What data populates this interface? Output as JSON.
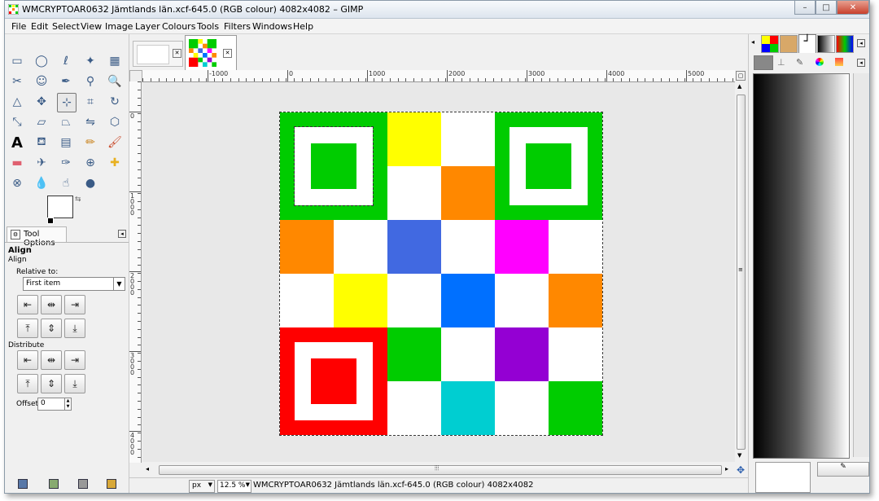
{
  "window": {
    "title": "WMCRYPTOAR0632 Jämtlands län.xcf-645.0 (RGB colour) 4082x4082 – GIMP",
    "minimize": "–",
    "maximize": "□",
    "close": "✕"
  },
  "menu": [
    "File",
    "Edit",
    "Select",
    "View",
    "Image",
    "Layer",
    "Colours",
    "Tools",
    "Filters",
    "Windows",
    "Help"
  ],
  "toolbox": {
    "tools": [
      "rect-select-icon",
      "ellipse-select-icon",
      "free-select-icon",
      "fuzzy-select-icon",
      "color-select-icon",
      "scissors-select-icon",
      "foreground-select-icon",
      "paths-icon",
      "color-picker-icon",
      "zoom-icon",
      "measure-icon",
      "move-icon",
      "align-icon",
      "crop-icon",
      "transform-icon",
      "scale-icon",
      "shear-icon",
      "perspective-icon",
      "flip-icon",
      "cage-icon",
      "text-icon",
      "bucket-fill-icon",
      "blend-icon",
      "pencil-icon",
      "paintbrush-icon",
      "eraser-icon",
      "airbrush-icon",
      "ink-icon",
      "clone-icon",
      "heal-icon",
      "perspective-clone-icon",
      "blur-icon",
      "smudge-icon",
      "dodge-burn-icon"
    ],
    "active_tool": "align-icon"
  },
  "tool_options": {
    "tab_label": "Tool Options",
    "heading": "Align",
    "subheading": "Align",
    "relative_label": "Relative to:",
    "relative_value": "First item",
    "distribute_label": "Distribute",
    "offset_label": "Offset:",
    "offset_value": "0"
  },
  "image": {
    "zoom_unit": "px",
    "zoom_value": "12.5 %",
    "status_text": "WMCRYPTOAR0632 Jämtlands län.xcf-645.0 (RGB colour) 4082x4082",
    "ruler_h_labels": [
      "-1000",
      "0",
      "1000",
      "2000",
      "3000",
      "4000",
      "5000"
    ],
    "ruler_v_labels": [
      "0",
      "1000",
      "2000",
      "3000",
      "4000"
    ]
  },
  "qr_grid": {
    "rows": 6,
    "cols": 6,
    "colors": {
      "green": "#00cc00",
      "yellow": "#ffff00",
      "orange": "#ff8800",
      "blue": "#4169e1",
      "magenta": "#ff00ff",
      "azure": "#0070ff",
      "red": "#ff0000",
      "purple": "#9400d3",
      "cyan": "#00ced1",
      "white": "#ffffff"
    },
    "cells": [
      [
        "finder-green",
        "finder-green",
        "yellow",
        "white",
        "finder-green",
        "finder-green"
      ],
      [
        "finder-green",
        "finder-green",
        "white",
        "orange",
        "finder-green",
        "finder-green"
      ],
      [
        "orange",
        "white",
        "blue",
        "white",
        "magenta",
        "white"
      ],
      [
        "white",
        "yellow",
        "white",
        "azure",
        "white",
        "orange"
      ],
      [
        "finder-red",
        "finder-red",
        "green",
        "white",
        "purple",
        "white"
      ],
      [
        "finder-red",
        "finder-red",
        "white",
        "cyan",
        "white",
        "green"
      ]
    ]
  }
}
